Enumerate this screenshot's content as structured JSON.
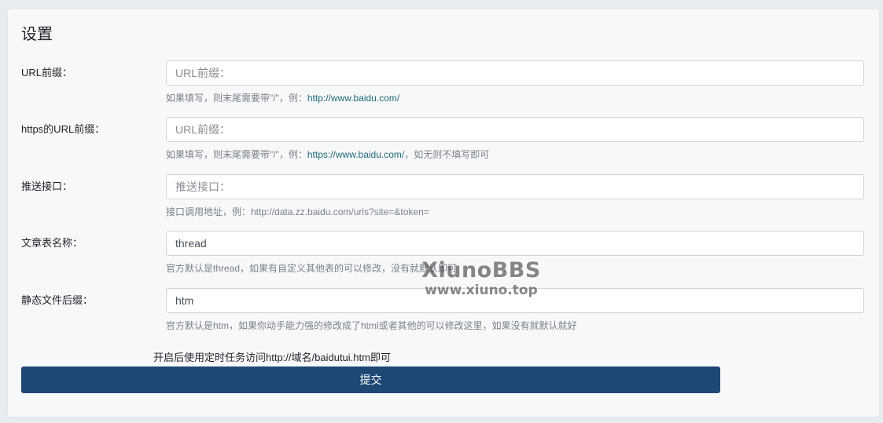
{
  "page": {
    "title": "设置"
  },
  "fields": [
    {
      "label": "URL前缀：",
      "placeholder": "URL前缀：",
      "value": "",
      "help_prefix": "如果填写，则末尾需要带\"/\"，例：",
      "help_link": "http://www.baidu.com/",
      "help_suffix": ""
    },
    {
      "label": "https的URL前缀：",
      "placeholder": "URL前缀：",
      "value": "",
      "help_prefix": "如果填写，则末尾需要带\"/\"，例：",
      "help_link": "https://www.baidu.com/",
      "help_suffix": "，如无则不填写即可"
    },
    {
      "label": "推送接口：",
      "placeholder": "推送接口：",
      "value": "",
      "help_prefix": "接口调用地址，例：http://data.zz.baidu.com/urls?site=&token=",
      "help_link": "",
      "help_suffix": ""
    },
    {
      "label": "文章表名称：",
      "placeholder": "",
      "value": "thread",
      "help_prefix": "官方默认是thread，如果有自定义其他表的可以修改，没有就默认即可",
      "help_link": "",
      "help_suffix": ""
    },
    {
      "label": "静态文件后缀：",
      "placeholder": "",
      "value": "htm",
      "help_prefix": "官方默认是htm，如果你动手能力强的修改成了html或者其他的可以修改这里，如果没有就默认就好",
      "help_link": "",
      "help_suffix": ""
    }
  ],
  "cron_note": "开启后使用定时任务访问http://域名/baidutui.htm即可",
  "submit_label": "提交",
  "watermark": {
    "title": "XiunoBBS",
    "url": "www.xiuno.top"
  },
  "colors": {
    "primary_button": "#1e4874",
    "link": "#1f6b75",
    "help_text": "#7b8188",
    "background": "#e9ecef",
    "card": "#f7f8fa"
  }
}
